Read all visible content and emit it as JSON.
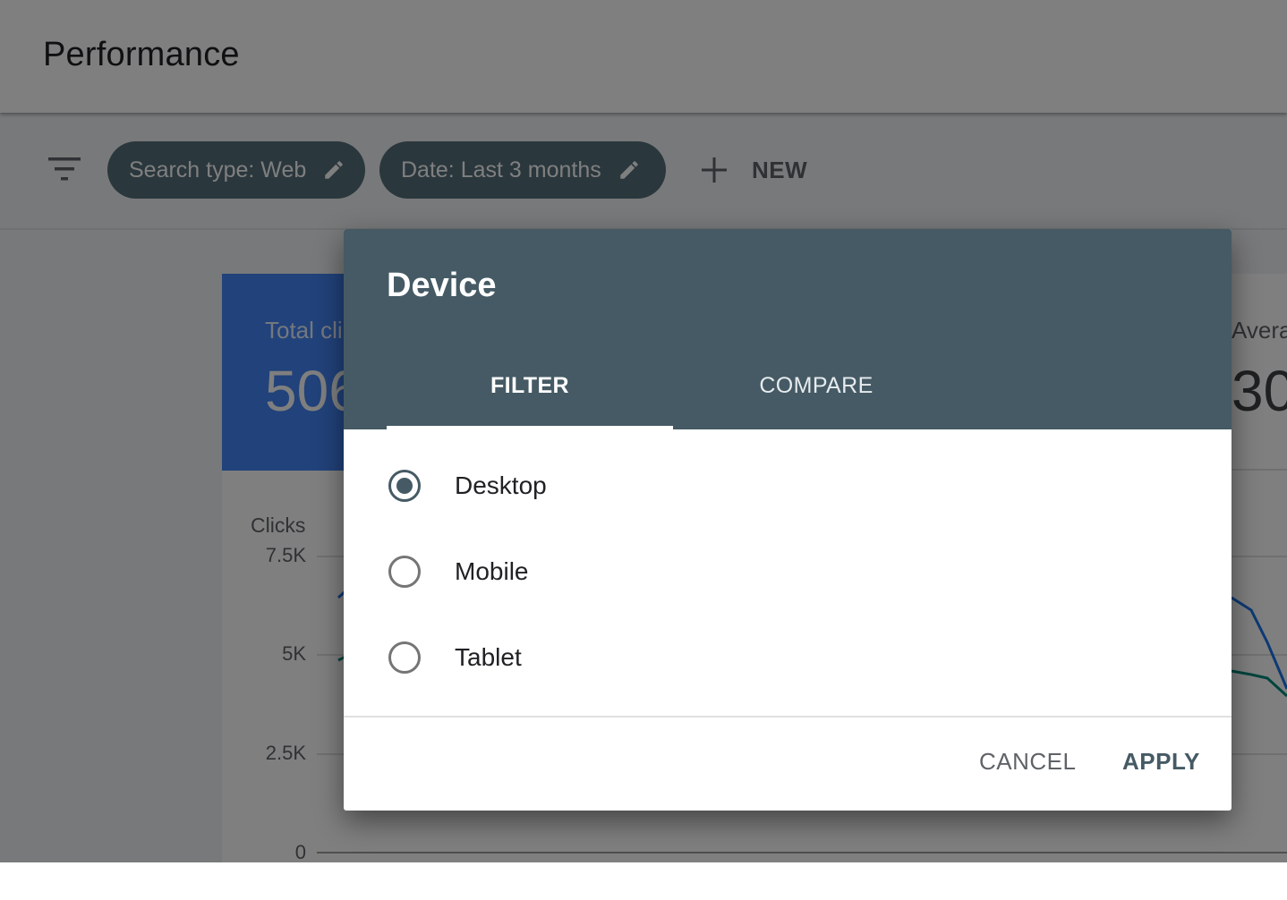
{
  "header": {
    "title": "Performance"
  },
  "filters": {
    "chips": [
      {
        "label": "Search type: Web"
      },
      {
        "label": "Date: Last 3 months"
      }
    ],
    "new_label": "NEW"
  },
  "metrics": {
    "total_clicks_label": "Total cli",
    "total_clicks_value": "506",
    "right_label": "Avera",
    "right_value": "30"
  },
  "chart": {
    "ylabel": "Clicks",
    "ticks": [
      "7.5K",
      "5K",
      "2.5K",
      "0"
    ]
  },
  "dialog": {
    "title": "Device",
    "tabs": [
      {
        "label": "FILTER",
        "active": true
      },
      {
        "label": "COMPARE",
        "active": false
      }
    ],
    "options": [
      {
        "label": "Desktop",
        "selected": true
      },
      {
        "label": "Mobile",
        "selected": false
      },
      {
        "label": "Tablet",
        "selected": false
      }
    ],
    "cancel_label": "CANCEL",
    "apply_label": "APPLY"
  },
  "colors": {
    "dialog_header": "#455a64",
    "chip": "#546e7a",
    "metric_blue": "#4285f4",
    "accent": "#455a64"
  }
}
